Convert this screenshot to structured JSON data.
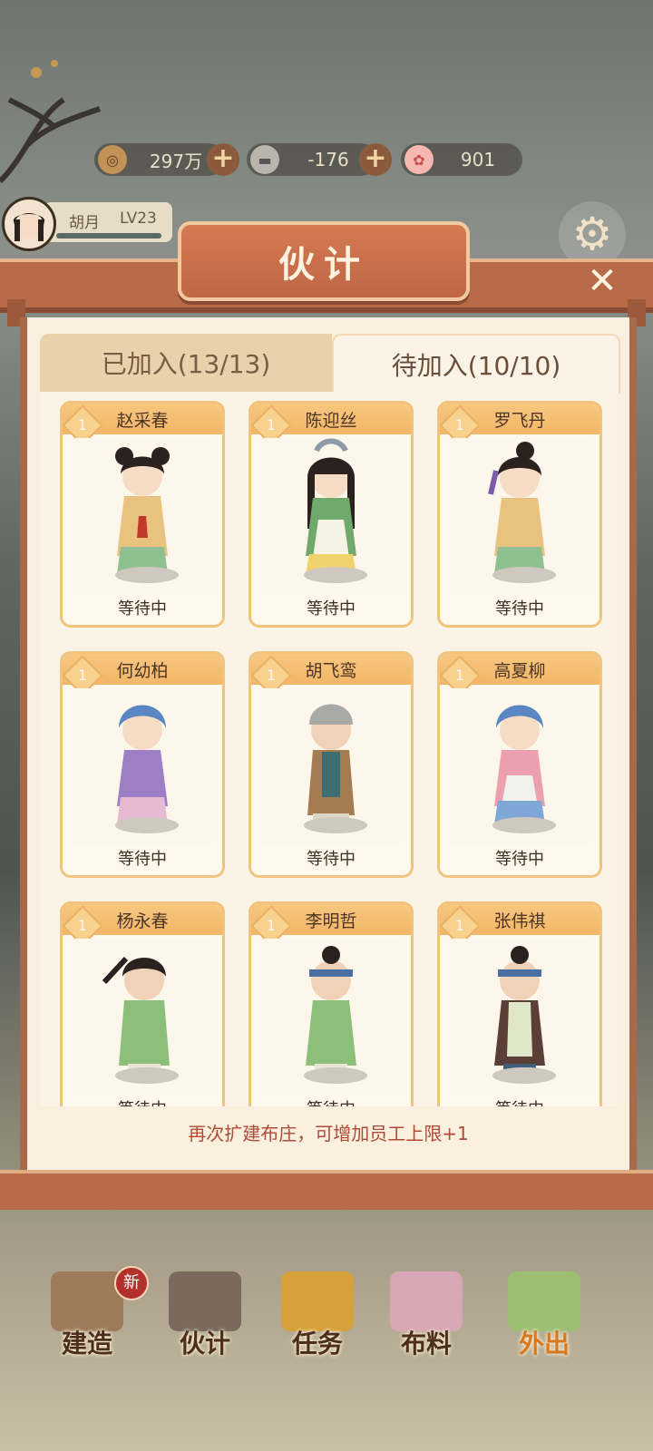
{
  "resources": [
    {
      "icon": "coin-icon",
      "value": "297万"
    },
    {
      "icon": "silver-ingot-icon",
      "value": "-176"
    },
    {
      "icon": "flower-icon",
      "value": "901"
    }
  ],
  "player": {
    "name": "胡月",
    "level": "LV23"
  },
  "panel": {
    "title": "伙计",
    "tabs": [
      {
        "label": "已加入(13/13)"
      },
      {
        "label": "待加入(10/10)"
      }
    ],
    "cards": [
      {
        "name": "赵采春",
        "level": "1",
        "status": "等待中"
      },
      {
        "name": "陈迎丝",
        "level": "1",
        "status": "等待中"
      },
      {
        "name": "罗飞丹",
        "level": "1",
        "status": "等待中"
      },
      {
        "name": "何幼柏",
        "level": "1",
        "status": "等待中"
      },
      {
        "name": "胡飞鸾",
        "level": "1",
        "status": "等待中"
      },
      {
        "name": "高夏柳",
        "level": "1",
        "status": "等待中"
      },
      {
        "name": "杨永春",
        "level": "1",
        "status": "等待中"
      },
      {
        "name": "李明哲",
        "level": "1",
        "status": "等待中"
      },
      {
        "name": "张伟祺",
        "level": "1",
        "status": "等待中"
      }
    ],
    "footer": "再次扩建布庄，可增加员工上限+1"
  },
  "nav": [
    {
      "label": "建造",
      "badge": "新"
    },
    {
      "label": "伙计"
    },
    {
      "label": "任务"
    },
    {
      "label": "布料"
    },
    {
      "label": "外出"
    }
  ],
  "colors": {
    "accent": "#b86a49",
    "card_border": "#f0c47f",
    "footer_text": "#b04a39"
  }
}
